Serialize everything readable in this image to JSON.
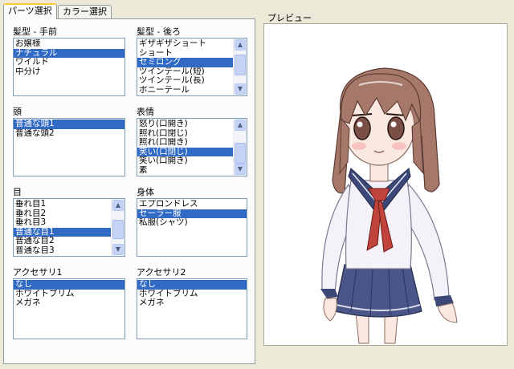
{
  "tabs": [
    {
      "label": "パーツ選択",
      "active": true
    },
    {
      "label": "カラー選択",
      "active": false
    }
  ],
  "groups": {
    "hair_front": {
      "label": "髪型 - 手前",
      "items": [
        "お嬢様",
        "ナチュラル",
        "ワイルド",
        "中分け"
      ],
      "selected": 1
    },
    "hair_back": {
      "label": "髪型 - 後ろ",
      "items": [
        "ギザギザショート",
        "ショート",
        "セミロング",
        "ツインテール(短)",
        "ツインテール(長)",
        "ポニーテール"
      ],
      "selected": 2
    },
    "head": {
      "label": "頭",
      "items": [
        "普通な頭1",
        "普通な頭2"
      ],
      "selected": 0
    },
    "expression": {
      "label": "表情",
      "items": [
        "怒り(口開き)",
        "照れ(口閉じ)",
        "照れ(口開き)",
        "笑い(口閉じ)",
        "笑い(口開き)",
        "素"
      ],
      "selected": 3
    },
    "eyes": {
      "label": "目",
      "items": [
        "垂れ目1",
        "垂れ目2",
        "垂れ目3",
        "普通な目1",
        "普通な目2",
        "普通な目3"
      ],
      "selected": 3
    },
    "body": {
      "label": "身体",
      "items": [
        "エプロンドレス",
        "セーラー服",
        "私服(シャツ)"
      ],
      "selected": 1
    },
    "accessory1": {
      "label": "アクセサリ1",
      "items": [
        "なし",
        "ホワイトブリム",
        "メガネ"
      ],
      "selected": 0
    },
    "accessory2": {
      "label": "アクセサリ2",
      "items": [
        "なし",
        "ホワイトブリム",
        "メガネ"
      ],
      "selected": 0
    }
  },
  "preview": {
    "label": "プレビュー"
  },
  "colors": {
    "selection": "#316ac5",
    "hair": "#a6786a",
    "uniform": "#3c4878",
    "tie": "#c0443c",
    "sleeve": "#f4f2f8"
  }
}
